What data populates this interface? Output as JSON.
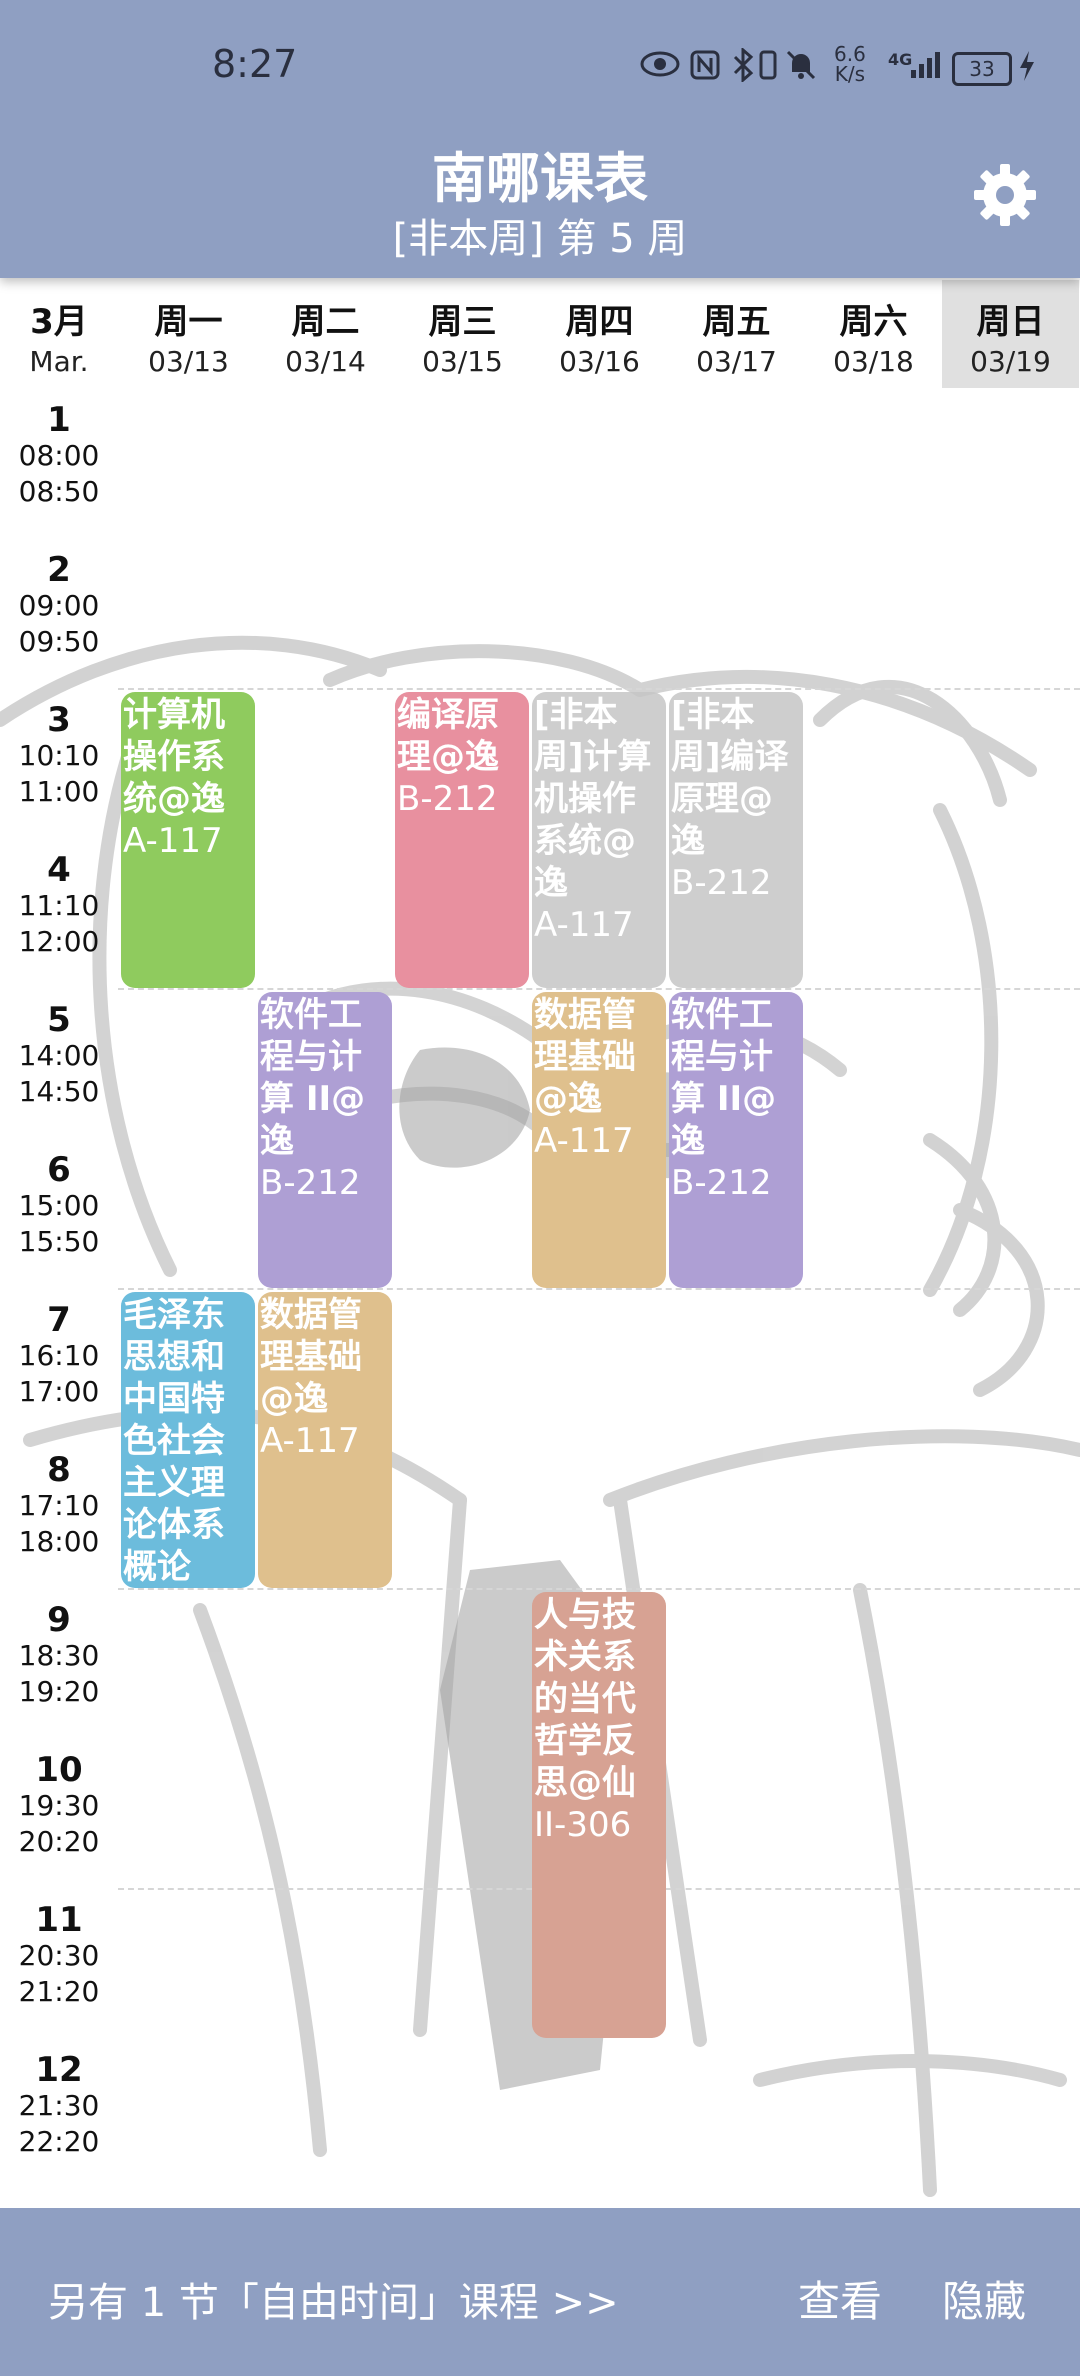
{
  "status_bar": {
    "time": "8:27",
    "net_speed": "6.6\nK/s",
    "signal": "4G",
    "battery": "33"
  },
  "header": {
    "title": "南哪课表",
    "week": "[非本周] 第 5 周"
  },
  "month": {
    "cn": "3月",
    "en": "Mar."
  },
  "days": [
    {
      "w": "周一",
      "d": "03/13"
    },
    {
      "w": "周二",
      "d": "03/14"
    },
    {
      "w": "周三",
      "d": "03/15"
    },
    {
      "w": "周四",
      "d": "03/16"
    },
    {
      "w": "周五",
      "d": "03/17"
    },
    {
      "w": "周六",
      "d": "03/18"
    },
    {
      "w": "周日",
      "d": "03/19"
    }
  ],
  "periods": [
    {
      "n": "1",
      "s": "08:00",
      "e": "08:50"
    },
    {
      "n": "2",
      "s": "09:00",
      "e": "09:50"
    },
    {
      "n": "3",
      "s": "10:10",
      "e": "11:00"
    },
    {
      "n": "4",
      "s": "11:10",
      "e": "12:00"
    },
    {
      "n": "5",
      "s": "14:00",
      "e": "14:50"
    },
    {
      "n": "6",
      "s": "15:00",
      "e": "15:50"
    },
    {
      "n": "7",
      "s": "16:10",
      "e": "17:00"
    },
    {
      "n": "8",
      "s": "17:10",
      "e": "18:00"
    },
    {
      "n": "9",
      "s": "18:30",
      "e": "19:20"
    },
    {
      "n": "10",
      "s": "19:30",
      "e": "20:20"
    },
    {
      "n": "11",
      "s": "20:30",
      "e": "21:20"
    },
    {
      "n": "12",
      "s": "21:30",
      "e": "22:20"
    }
  ],
  "courses": [
    {
      "name": "计算机操作系统@逸",
      "room": "A-117",
      "day": 1,
      "start": 3,
      "len": 2,
      "color": "#8fcb5e"
    },
    {
      "name": "编译原理@逸",
      "room": "B-212",
      "day": 3,
      "start": 3,
      "len": 2,
      "color": "#e8909f"
    },
    {
      "name": "[非本周]计算机操作系统@逸",
      "room": "A-117",
      "day": 4,
      "start": 3,
      "len": 2,
      "color": "#c6c6c6"
    },
    {
      "name": "[非本周]编译原理@逸",
      "room": "B-212",
      "day": 5,
      "start": 3,
      "len": 2,
      "color": "#c6c6c6"
    },
    {
      "name": "软件工程与计算 II@逸",
      "room": "B-212",
      "day": 2,
      "start": 5,
      "len": 2,
      "color": "#ae9fd4"
    },
    {
      "name": "数据管理基础@逸",
      "room": "A-117",
      "day": 4,
      "start": 5,
      "len": 2,
      "color": "#dfc08d"
    },
    {
      "name": "软件工程与计算 II@逸",
      "room": "B-212",
      "day": 5,
      "start": 5,
      "len": 2,
      "color": "#ae9fd4"
    },
    {
      "name": "毛泽东思想和中国特色社会主义理论体系概论",
      "room": "",
      "day": 1,
      "start": 7,
      "len": 2,
      "color": "#6cbcdc"
    },
    {
      "name": "数据管理基础@逸",
      "room": "A-117",
      "day": 2,
      "start": 7,
      "len": 2,
      "color": "#dfc08d"
    },
    {
      "name": "人与技术关系的当代哲学反思@仙",
      "room": "II-306",
      "day": 4,
      "start": 9,
      "len": 3,
      "color": "#d7a293"
    }
  ],
  "bottom": {
    "message": "另有 1 节「自由时间」课程 >>",
    "view": "查看",
    "hide": "隐藏"
  },
  "colors": {
    "header_bg": "#8f9fc2",
    "today_bg": "#e0e0e0"
  },
  "icons": {
    "settings": "gear-icon"
  }
}
